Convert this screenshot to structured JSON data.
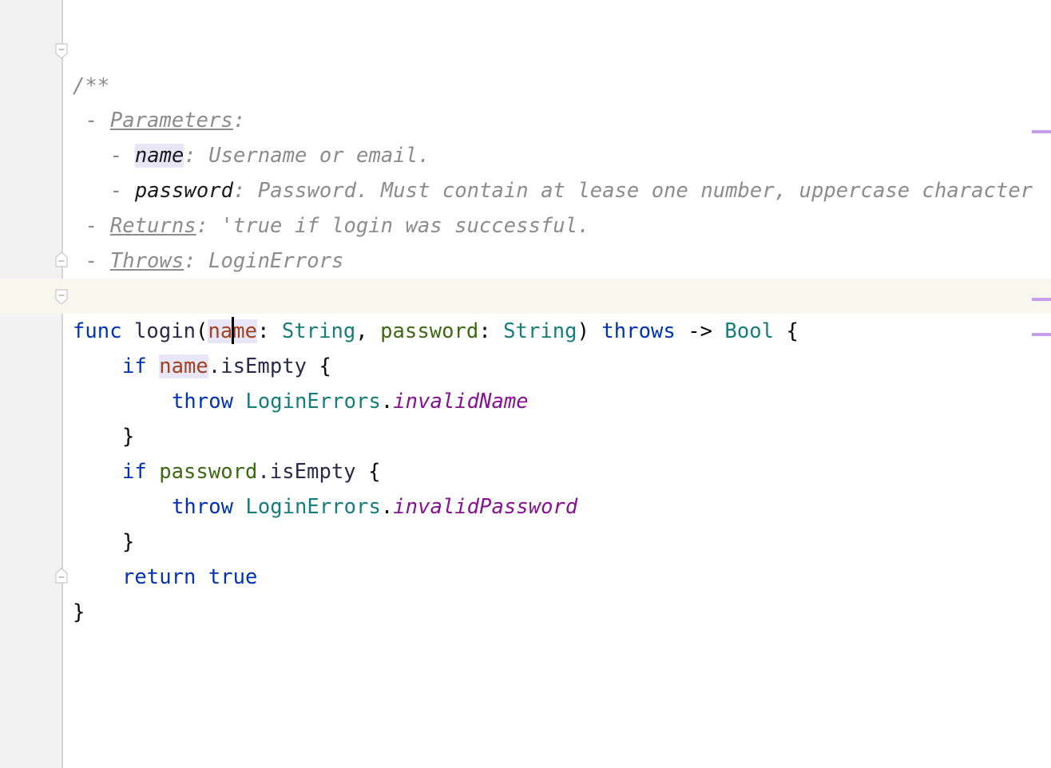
{
  "editor": {
    "language": "Swift",
    "doc_comment": {
      "open": "/**",
      "params_dash": "- ",
      "params_tag": "Parameters",
      "params_colon": ":",
      "name_dash": "- ",
      "name_param": "name",
      "name_desc": ": Username or email.",
      "pw_dash": "- ",
      "pw_param": "password",
      "pw_desc": ": Password. Must contain at lease one number, uppercase character",
      "returns_dash": "- ",
      "returns_tag": "Returns",
      "returns_desc": ": 'true if login was successful.",
      "throws_dash": "- ",
      "throws_tag": "Throws",
      "throws_desc": ": LoginErrors",
      "close": " */"
    },
    "code": {
      "func_kw": "func",
      "func_name": "login",
      "open_paren": "(",
      "p1_a": "na",
      "p1_b": "me",
      "colon1": ": ",
      "type1": "String",
      "comma": ", ",
      "p2": "password",
      "colon2": ": ",
      "type2": "String",
      "close_paren": ")",
      "throws_kw": "throws",
      "arrow": "->",
      "ret_type": "Bool",
      "brace_open": "{",
      "if1_kw": "if",
      "if1_var": "name",
      "if1_prop": ".isEmpty",
      "if1_brace": "{",
      "throw1_kw": "throw",
      "throw1_type": "LoginErrors",
      "throw1_dot": ".",
      "throw1_member": "invalidName",
      "close1": "}",
      "if2_kw": "if",
      "if2_var": "password",
      "if2_prop": ".isEmpty",
      "if2_brace": "{",
      "throw2_kw": "throw",
      "throw2_type": "LoginErrors",
      "throw2_dot": ".",
      "throw2_member": "invalidPassword",
      "close2": "}",
      "return_kw": "return",
      "return_val": "true",
      "brace_close": "}"
    },
    "colors": {
      "keyword": "#0033b3",
      "parameter": "#a0421c",
      "type": "#167d7d",
      "member": "#871094",
      "comment": "#8c8c8c",
      "marker": "#c89ded"
    }
  }
}
